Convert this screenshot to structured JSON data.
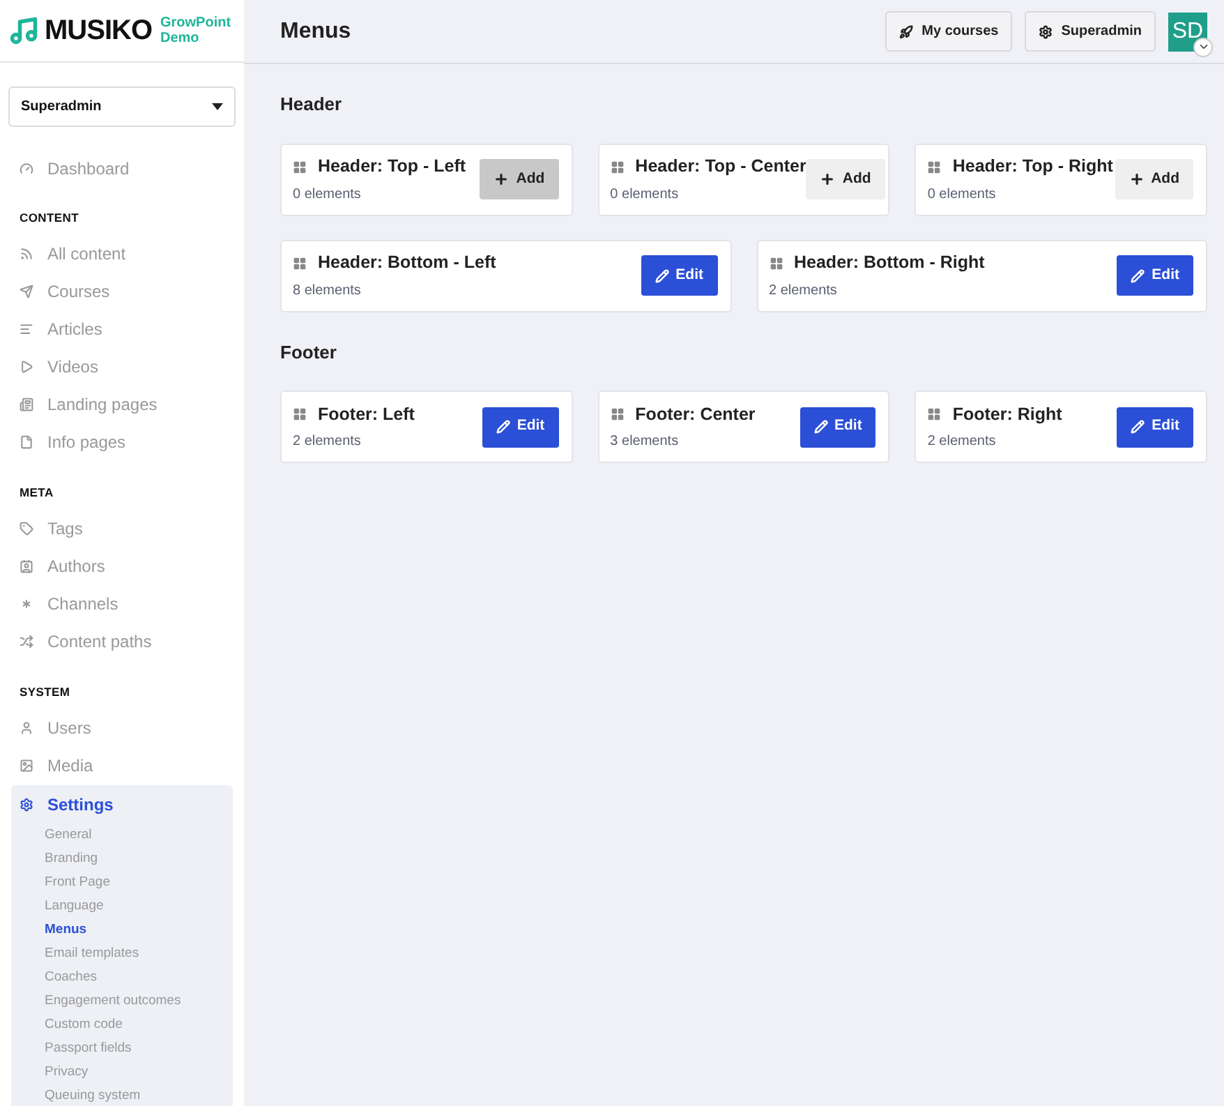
{
  "logo": {
    "name": "MUSIKO",
    "tagline_1": "GrowPoint",
    "tagline_2": "Demo"
  },
  "role_select": {
    "value": "Superadmin"
  },
  "nav": [
    {
      "kind": "item",
      "label": "Dashboard",
      "selected": false
    },
    {
      "kind": "heading",
      "label": "CONTENT"
    },
    {
      "kind": "item",
      "label": "All content",
      "selected": false
    },
    {
      "kind": "item",
      "label": "Courses",
      "selected": false
    },
    {
      "kind": "item",
      "label": "Articles",
      "selected": false
    },
    {
      "kind": "item",
      "label": "Videos",
      "selected": false
    },
    {
      "kind": "item",
      "label": "Landing pages",
      "selected": false
    },
    {
      "kind": "item",
      "label": "Info pages",
      "selected": false
    },
    {
      "kind": "heading",
      "label": "META"
    },
    {
      "kind": "item",
      "label": "Tags",
      "selected": false
    },
    {
      "kind": "item",
      "label": "Authors",
      "selected": false
    },
    {
      "kind": "item",
      "label": "Channels",
      "selected": false
    },
    {
      "kind": "item",
      "label": "Content paths",
      "selected": false
    },
    {
      "kind": "heading",
      "label": "SYSTEM"
    },
    {
      "kind": "item",
      "label": "Users",
      "selected": false
    },
    {
      "kind": "item",
      "label": "Media",
      "selected": false
    },
    {
      "kind": "item",
      "label": "Settings",
      "selected": true,
      "children": [
        {
          "label": "General",
          "selected": false
        },
        {
          "label": "Branding",
          "selected": false
        },
        {
          "label": "Front Page",
          "selected": false
        },
        {
          "label": "Language",
          "selected": false
        },
        {
          "label": "Menus",
          "selected": true
        },
        {
          "label": "Email templates",
          "selected": false
        },
        {
          "label": "Coaches",
          "selected": false
        },
        {
          "label": "Engagement outcomes",
          "selected": false
        },
        {
          "label": "Custom code",
          "selected": false
        },
        {
          "label": "Passport fields",
          "selected": false
        },
        {
          "label": "Privacy",
          "selected": false
        },
        {
          "label": "Queuing system",
          "selected": false
        }
      ]
    }
  ],
  "page_title": "Menus",
  "top_buttons": [
    "My courses",
    "Superadmin"
  ],
  "avatar": {
    "initials": "SD"
  },
  "sections": [
    {
      "title": "Header",
      "rows": [
        [
          {
            "title": "Header: Top - Left",
            "count": "0 elements",
            "button": {
              "kind": "add",
              "label": "Add",
              "hovered": true
            }
          },
          {
            "title": "Header: Top - Center",
            "count": "0 elements",
            "button": {
              "kind": "add",
              "label": "Add",
              "hovered": false
            }
          },
          {
            "title": "Header: Top - Right",
            "count": "0 elements",
            "button": {
              "kind": "add",
              "label": "Add",
              "hovered": false
            }
          }
        ],
        [
          {
            "title": "Header: Bottom - Left",
            "count": "8 elements",
            "button": {
              "kind": "edit",
              "label": "Edit",
              "hovered": false
            }
          },
          {
            "title": "Header: Bottom - Right",
            "count": "2 elements",
            "button": {
              "kind": "edit",
              "label": "Edit",
              "hovered": false
            }
          }
        ]
      ]
    },
    {
      "title": "Footer",
      "rows": [
        [
          {
            "title": "Footer: Left",
            "count": "2 elements",
            "button": {
              "kind": "edit",
              "label": "Edit",
              "hovered": false
            }
          },
          {
            "title": "Footer: Center",
            "count": "3 elements",
            "button": {
              "kind": "edit",
              "label": "Edit",
              "hovered": false
            }
          },
          {
            "title": "Footer: Right",
            "count": "2 elements",
            "button": {
              "kind": "edit",
              "label": "Edit",
              "hovered": false
            }
          }
        ]
      ]
    }
  ]
}
